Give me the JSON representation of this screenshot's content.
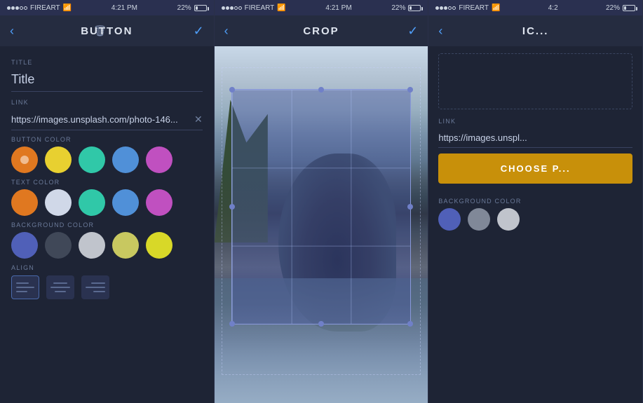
{
  "panels": [
    {
      "id": "button-panel",
      "statusBar": {
        "signal": "●●●○○",
        "carrier": "FIREART",
        "wifi": "wifi",
        "time": "4:21 PM",
        "battery": "22%"
      },
      "nav": {
        "title": "BUTTON",
        "back": "‹",
        "trash": "🗑",
        "check": "✓"
      },
      "sections": [
        {
          "label": "TITLE",
          "type": "input",
          "value": "Title"
        },
        {
          "label": "LINK",
          "type": "link",
          "value": "https://images.unsplash.com/photo-146..."
        },
        {
          "label": "BUTTON COLOR",
          "type": "colors",
          "colors": [
            "#e07820",
            "#e8d030",
            "#30c8a8",
            "#5090d8",
            "#c050c0"
          ]
        },
        {
          "label": "TEXT COLOR",
          "type": "colors",
          "colors": [
            "#e07820",
            "#d0d8e8",
            "#30c8a8",
            "#5090d8",
            "#c050c0"
          ]
        },
        {
          "label": "BACKGROUND COLOR",
          "type": "colors",
          "colors": [
            "#5060b8",
            "#404858",
            "#c0c4cc",
            "#c8c860",
            "#d8d828"
          ]
        },
        {
          "label": "ALIGN",
          "type": "align"
        }
      ]
    },
    {
      "id": "crop-panel",
      "statusBar": {
        "signal": "●●●○○",
        "carrier": "FIREART",
        "wifi": "wifi",
        "time": "4:21 PM",
        "battery": "22%"
      },
      "nav": {
        "title": "CROP",
        "back": "‹",
        "check": "✓"
      }
    },
    {
      "id": "image-panel",
      "statusBar": {
        "signal": "●●●○○",
        "carrier": "FIREART",
        "wifi": "wifi",
        "time": "4:2",
        "battery": "22%"
      },
      "nav": {
        "title": "IC...",
        "back": "‹"
      },
      "link": {
        "label": "LINK",
        "value": "https://images.unspl..."
      },
      "chooseBtn": "CHOOSE P...",
      "bgColorLabel": "BACKGROUND COLOR",
      "bgColors": [
        "#5060b8",
        "#808898",
        "#c0c4cc"
      ]
    }
  ]
}
